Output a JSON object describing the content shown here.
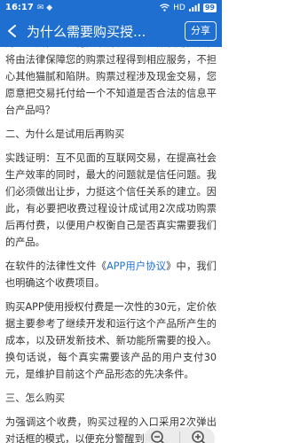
{
  "status_bar": {
    "time": "16:17",
    "notification": "✉ ◆",
    "signal_text": "HD",
    "battery": "99"
  },
  "app_bar": {
    "title": "为什么需要购买授...",
    "share_label": "分享"
  },
  "article": {
    "para_intro": "另一方面，您的付费取得合法的产品使用授权，将由法律保障您的购票过程得到相应服务，不担心其他猫腻和陷阱。购票过程涉及现金交易，您愿意把交易托付给一个不知道是否合法的信息平台产品吗？",
    "heading_2": "二、为什么是试用后再购买",
    "para_2a": "实践证明：互不见面的互联网交易，在提高社会生产效率的同时，最大的问题就是信任问题。我们必须做出让步，力挺这个信任关系的建立。因此，有必要把收费过程设计成试用2次成功购票后再付费，以便用户权衡自己是否真实需要我们的产品。",
    "para_2b_prefix": "在软件的法律性文件《",
    "para_2b_link": "APP用户协议",
    "para_2b_suffix": "》中，我们也明确这个收费项目。",
    "para_2c": "购买APP使用授权付费是一次性的30元，定价依据主要参考了继续开发和运行这个产品所产生的成本，以及研发新技术、新功能所需要的投入。换句话说，每个真实需要该产品的用户支付30元，是维护目前这个产品形态的先决条件。",
    "heading_3": "三、怎么购买",
    "para_3": "为强调这个收费，购买过程的入口采用2次弹出对话框的模式，以便充分警醒到用户。"
  },
  "zoom": {
    "out_icon": "zoom-out",
    "in_icon": "zoom-in"
  },
  "colors": {
    "primary": "#1f6fd1",
    "text": "#333333"
  }
}
